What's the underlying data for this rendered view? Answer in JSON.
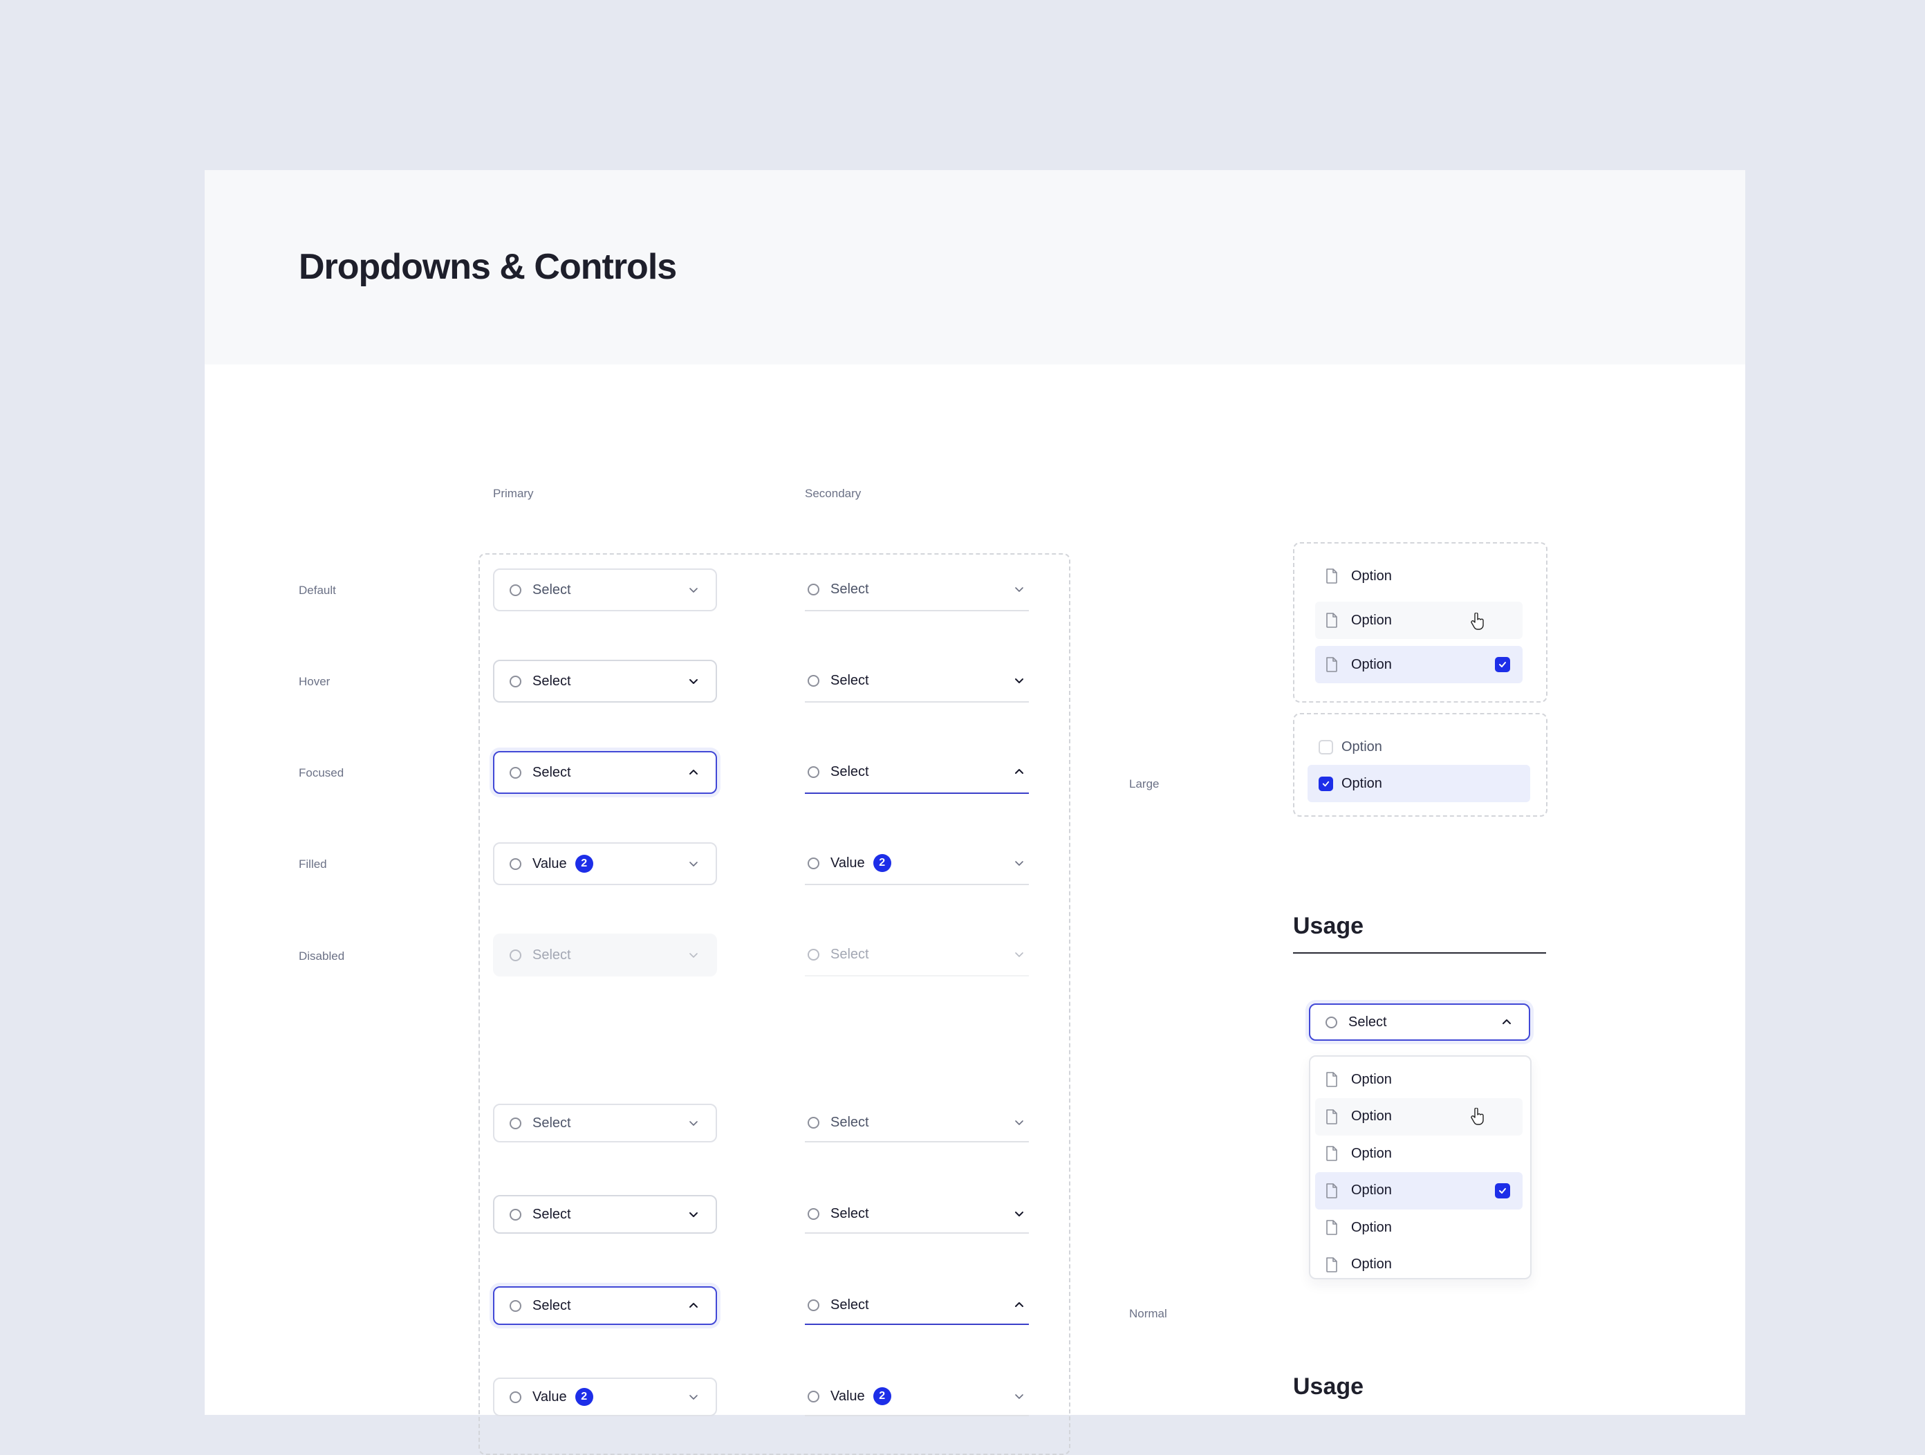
{
  "page": {
    "title": "Dropdowns & Controls"
  },
  "columns": {
    "primary": "Primary",
    "secondary": "Secondary"
  },
  "states": {
    "default": "Default",
    "hover": "Hover",
    "focused": "Focused",
    "filled": "Filled",
    "disabled": "Disabled"
  },
  "sizes": {
    "large": "Large",
    "normal": "Normal"
  },
  "fields": {
    "placeholder": "Select",
    "filled_value": "Value",
    "filled_badge_count": "2"
  },
  "option_list": {
    "items": [
      {
        "label": "Option",
        "state": "default",
        "checked": false
      },
      {
        "label": "Option",
        "state": "hover",
        "checked": false
      },
      {
        "label": "Option",
        "state": "selected",
        "checked": true
      }
    ]
  },
  "checkbox_list": {
    "items": [
      {
        "label": "Option",
        "checked": false
      },
      {
        "label": "Option",
        "checked": true
      }
    ]
  },
  "usage": {
    "heading": "Usage",
    "select_label": "Select",
    "menu_items": [
      {
        "label": "Option",
        "state": "default",
        "checked": false
      },
      {
        "label": "Option",
        "state": "hover",
        "checked": false
      },
      {
        "label": "Option",
        "state": "default",
        "checked": false
      },
      {
        "label": "Option",
        "state": "selected",
        "checked": true
      },
      {
        "label": "Option",
        "state": "default",
        "checked": false
      },
      {
        "label": "Option",
        "state": "default",
        "checked": false
      }
    ],
    "heading_2": "Usage"
  },
  "colors": {
    "accent": "#1d2ee8",
    "focus_border": "#4148d6",
    "selected_bg": "#ebeefc",
    "page_bg": "#e5e8f1",
    "header_bg": "#f7f8fa"
  }
}
